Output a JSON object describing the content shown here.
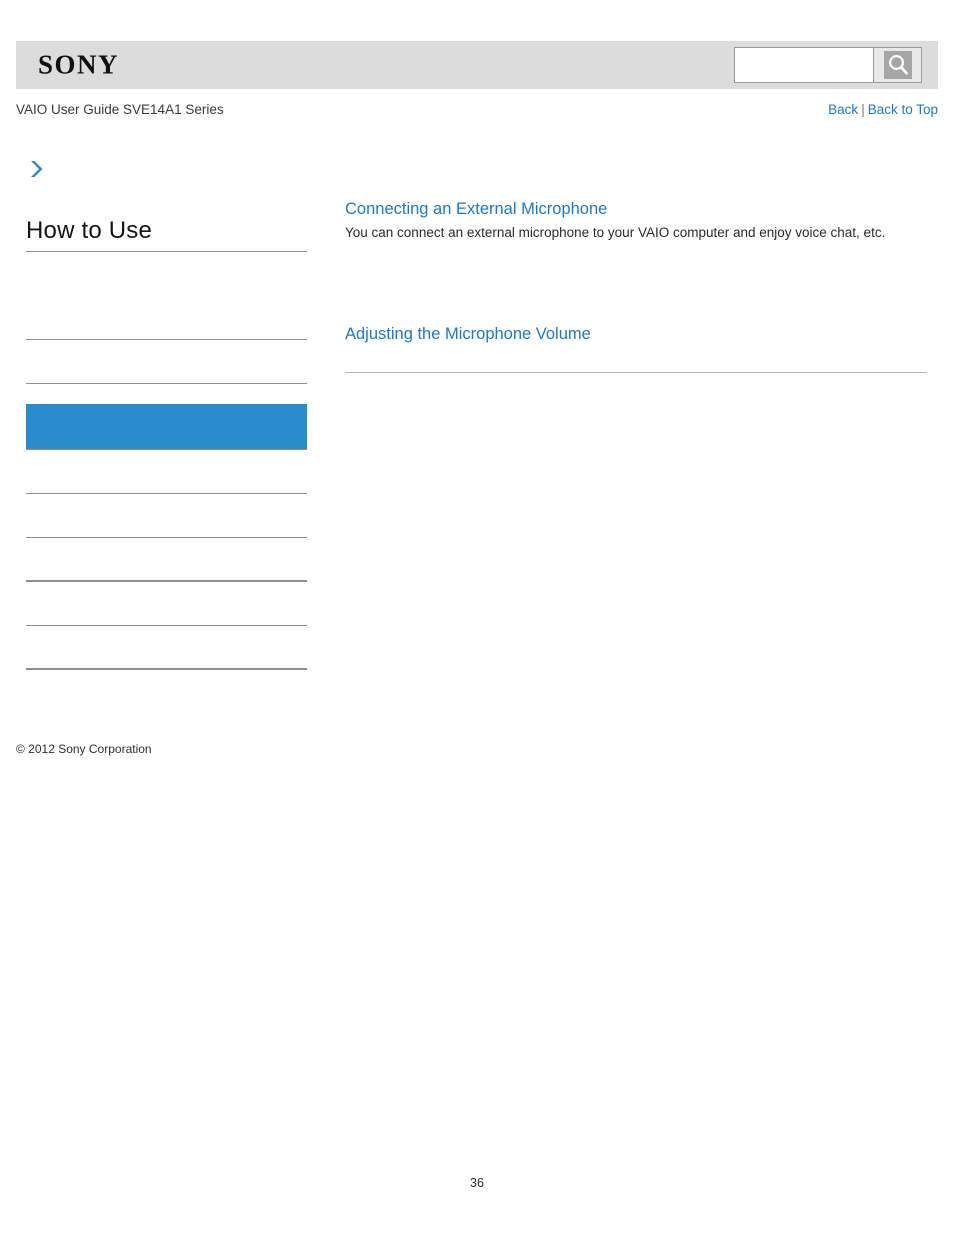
{
  "header": {
    "logo_text": "SONY",
    "logo_icon": "sony-wordmark",
    "search": {
      "value": "",
      "placeholder": "",
      "button_icon": "search-icon"
    }
  },
  "breadcrumb": {
    "guide_title": "VAIO User Guide SVE14A1 Series",
    "back_label": "Back",
    "separator": "|",
    "back_to_top_label": "Back to Top"
  },
  "sidebar": {
    "arrow_icon": "chevron-right-icon",
    "heading": "How to Use",
    "items": [
      {
        "label": "",
        "selected": false,
        "rule": "none"
      },
      {
        "label": "",
        "selected": false,
        "rule": "thin"
      },
      {
        "label": "",
        "selected": false,
        "rule": "thin"
      },
      {
        "label": "",
        "selected": false,
        "rule": "thin"
      },
      {
        "label": "",
        "selected": true,
        "rule": "thin"
      },
      {
        "label": "",
        "selected": false,
        "rule": "thin"
      },
      {
        "label": "",
        "selected": false,
        "rule": "thin"
      },
      {
        "label": "",
        "selected": false,
        "rule": "thick"
      },
      {
        "label": "",
        "selected": false,
        "rule": "thin"
      },
      {
        "label": "",
        "selected": false,
        "rule": "thick"
      }
    ],
    "copyright": "© 2012 Sony Corporation"
  },
  "main": {
    "topics": [
      {
        "title": "Connecting an External Microphone",
        "description": "You can connect an external microphone to your VAIO computer and enjoy voice chat, etc.",
        "has_rule": false
      },
      {
        "title": "Adjusting the Microphone Volume",
        "description": "",
        "has_rule": true
      }
    ]
  },
  "footer": {
    "page_number": "36"
  },
  "colors": {
    "link_blue": "#1a7ac7",
    "selected_blue": "#2b8ccd",
    "header_gray": "#dcdcdc",
    "rule_gray": "#8e8e8e"
  }
}
